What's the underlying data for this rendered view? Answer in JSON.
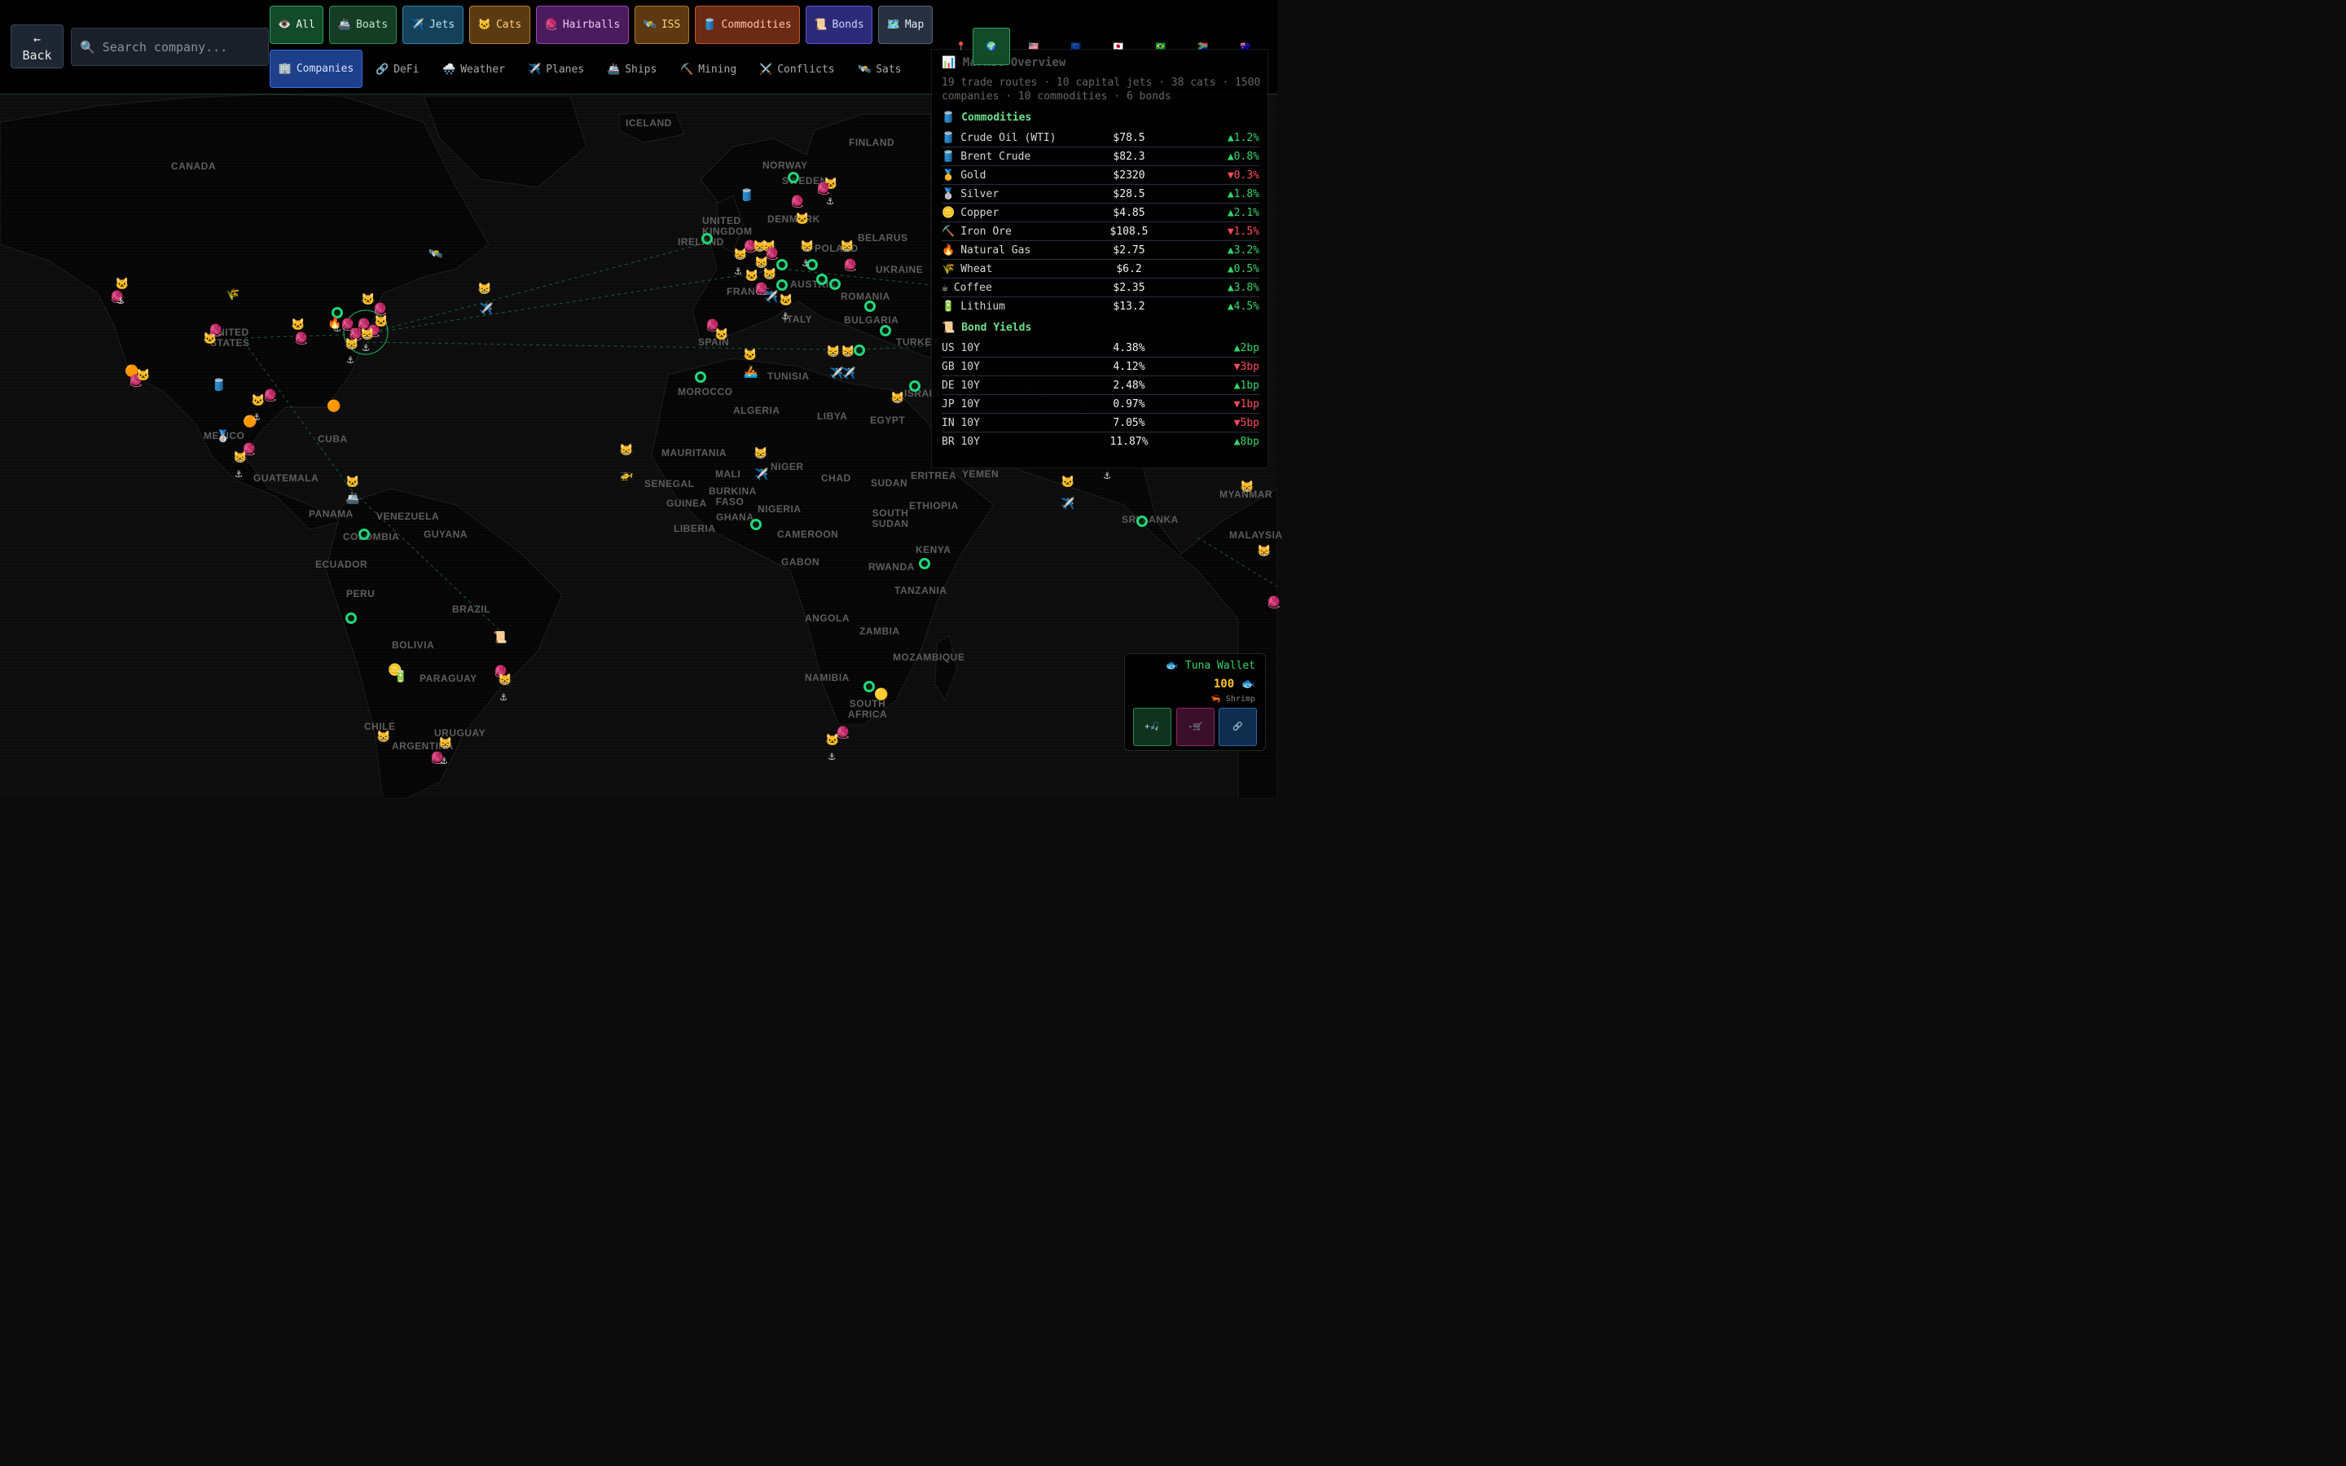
{
  "header": {
    "back_label": "← Back",
    "search_placeholder": "🔍 Search company...",
    "tabs": [
      {
        "icon": "👁️",
        "label": "All"
      },
      {
        "icon": "🚢",
        "label": "Boats"
      },
      {
        "icon": "✈️",
        "label": "Jets"
      },
      {
        "icon": "🐱",
        "label": "Cats"
      },
      {
        "icon": "🧶",
        "label": "Hairballs"
      },
      {
        "icon": "🛰️",
        "label": "ISS"
      },
      {
        "icon": "🛢️",
        "label": "Commodities"
      },
      {
        "icon": "📜",
        "label": "Bonds"
      },
      {
        "icon": "🗺️",
        "label": "Map"
      },
      {
        "icon": "🏢",
        "label": "Companies"
      }
    ],
    "tabs2": [
      {
        "icon": "🔗",
        "label": "DeFi"
      },
      {
        "icon": "🌨️",
        "label": "Weather"
      },
      {
        "icon": "✈️",
        "label": "Planes"
      },
      {
        "icon": "🚢",
        "label": "Ships"
      },
      {
        "icon": "⛏️",
        "label": "Mining"
      },
      {
        "icon": "⚔️",
        "label": "Conflicts"
      },
      {
        "icon": "🛰️",
        "label": "Sats"
      }
    ],
    "pin_icon": "📍",
    "flags": [
      "🌍",
      "🇺🇸",
      "🇪🇺",
      "🇯🇵",
      "🇧🇷",
      "🇿🇦",
      "🇦🇺"
    ]
  },
  "market": {
    "title": "📊 Market Overview",
    "subtitle": "19 trade routes · 10 capital jets · 38 cats · 1500 companies · 10 commodities · 6 bonds",
    "commodities_title": "Commodities",
    "commodities_icon": "🛢️",
    "commodities": [
      {
        "icon": "🛢️",
        "name": "Crude Oil (WTI)",
        "price": "$78.5",
        "change": "▲1.2%",
        "dir": "up"
      },
      {
        "icon": "🛢️",
        "name": "Brent Crude",
        "price": "$82.3",
        "change": "▲0.8%",
        "dir": "up"
      },
      {
        "icon": "🥇",
        "name": "Gold",
        "price": "$2320",
        "change": "▼0.3%",
        "dir": "dn"
      },
      {
        "icon": "🥈",
        "name": "Silver",
        "price": "$28.5",
        "change": "▲1.8%",
        "dir": "up"
      },
      {
        "icon": "🪙",
        "name": "Copper",
        "price": "$4.85",
        "change": "▲2.1%",
        "dir": "up"
      },
      {
        "icon": "⛏️",
        "name": "Iron Ore",
        "price": "$108.5",
        "change": "▼1.5%",
        "dir": "dn"
      },
      {
        "icon": "🔥",
        "name": "Natural Gas",
        "price": "$2.75",
        "change": "▲3.2%",
        "dir": "up"
      },
      {
        "icon": "🌾",
        "name": "Wheat",
        "price": "$6.2",
        "change": "▲0.5%",
        "dir": "up"
      },
      {
        "icon": "☕",
        "name": "Coffee",
        "price": "$2.35",
        "change": "▲3.8%",
        "dir": "up"
      },
      {
        "icon": "🔋",
        "name": "Lithium",
        "price": "$13.2",
        "change": "▲4.5%",
        "dir": "up"
      }
    ],
    "bonds_title": "Bond Yields",
    "bonds_icon": "📜",
    "bonds": [
      {
        "name": "US 10Y",
        "yield": "4.38%",
        "change": "▲2bp",
        "dir": "up"
      },
      {
        "name": "GB 10Y",
        "yield": "4.12%",
        "change": "▼3bp",
        "dir": "dn"
      },
      {
        "name": "DE 10Y",
        "yield": "2.48%",
        "change": "▲1bp",
        "dir": "up"
      },
      {
        "name": "JP 10Y",
        "yield": "0.97%",
        "change": "▼1bp",
        "dir": "dn"
      },
      {
        "name": "IN 10Y",
        "yield": "7.05%",
        "change": "▼5bp",
        "dir": "dn"
      },
      {
        "name": "BR 10Y",
        "yield": "11.87%",
        "change": "▲8bp",
        "dir": "up"
      }
    ]
  },
  "wallet": {
    "title": "🐟 Tuna Wallet",
    "amount": "100 🐟",
    "level": "🦐 Shrimp",
    "buttons": [
      "+🎣",
      "-🛒",
      "🔗"
    ]
  },
  "map_labels": [
    "CANADA",
    "ICELAND",
    "FINLAND",
    "NORWAY",
    "SWEDEN",
    "UNITED KINGDOM",
    "IRELAND",
    "DENMARK",
    "POLAND",
    "BELARUS",
    "UKRAINE",
    "FRANCE",
    "AUSTRIA",
    "ROMANIA",
    "BULGARIA",
    "ITALY",
    "SPAIN",
    "TURKEY",
    "UNITED STATES",
    "MEXICO",
    "CUBA",
    "GUATEMALA",
    "PANAMA",
    "VENEZUELA",
    "GUYANA",
    "COLOMBIA",
    "ECUADOR",
    "PERU",
    "BRAZIL",
    "BOLIVIA",
    "PARAGUAY",
    "CHILE",
    "URUGUAY",
    "ARGENTINA",
    "MOROCCO",
    "ALGERIA",
    "TUNISIA",
    "LIBYA",
    "EGYPT",
    "MAURITANIA",
    "MALI",
    "NIGER",
    "CHAD",
    "SUDAN",
    "ERITREA",
    "ETHIOPIA",
    "SENEGAL",
    "BURKINA FASO",
    "GUINEA",
    "GHANA",
    "LIBERIA",
    "NIGERIA",
    "CAMEROON",
    "SOUTH SUDAN",
    "GABON",
    "KENYA",
    "RWANDA",
    "TANZANIA",
    "ANGOLA",
    "ZAMBIA",
    "MOZAMBIQUE",
    "NAMIBIA",
    "SOUTH AFRICA",
    "YEMEN",
    "SRI LANKA",
    "MALAYSIA",
    "MYANMAR",
    "ISRAEL"
  ]
}
